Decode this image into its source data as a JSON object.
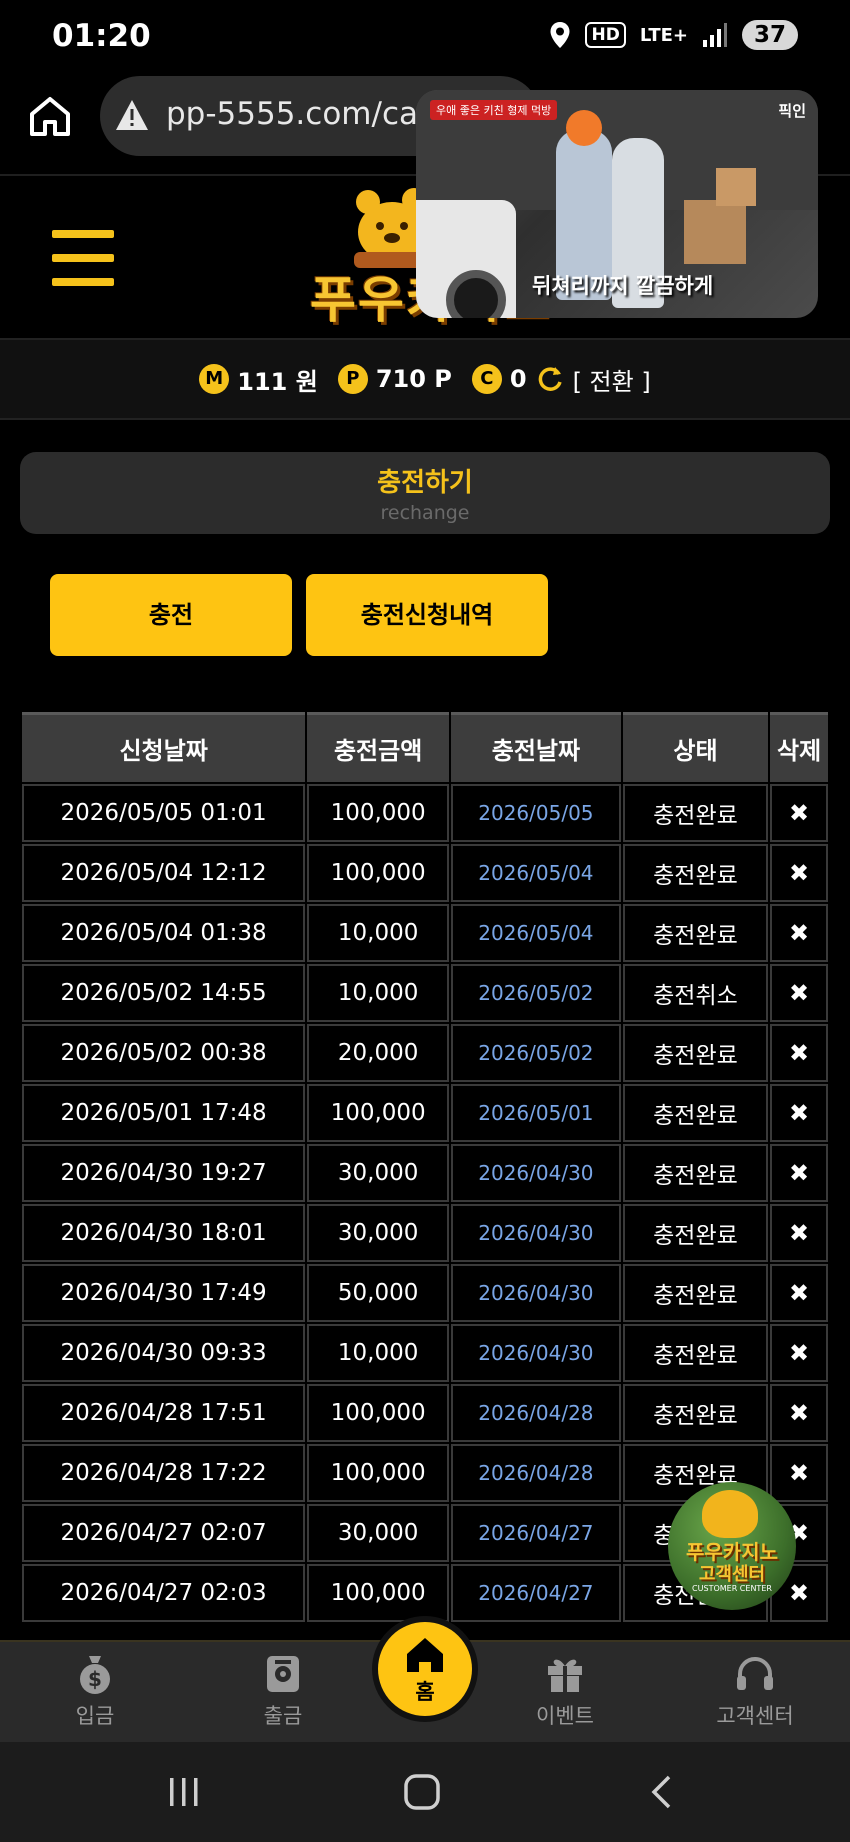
{
  "status_bar": {
    "time": "01:20",
    "hd": "HD",
    "network": "LTE+",
    "battery": "37"
  },
  "browser": {
    "url": "pp-5555.com/cas"
  },
  "pip_video": {
    "channel_tag": "우애 좋은 키친 형제 먹방",
    "corner_label": "픽인",
    "subtitle": "뒤쳐리까지 깔끔하게"
  },
  "header": {
    "logo_text": "푸우카지노"
  },
  "balance": {
    "money_icon": "M",
    "money": "111 원",
    "point_icon": "P",
    "points": "710 P",
    "casino_icon": "C",
    "casino": "0",
    "switch_label": "[ 전환 ]"
  },
  "page_title": {
    "title": "충전하기",
    "subtitle": "rechange"
  },
  "buttons": {
    "charge": "충전",
    "history": "충전신청내역"
  },
  "table": {
    "headers": [
      "신청날짜",
      "충전금액",
      "충전날짜",
      "상태",
      "삭제"
    ],
    "delete_symbol": "✖",
    "rows": [
      {
        "request_date": "2026/05/05 01:01",
        "amount": "100,000",
        "charge_date": "2026/05/05",
        "status": "충전완료"
      },
      {
        "request_date": "2026/05/04 12:12",
        "amount": "100,000",
        "charge_date": "2026/05/04",
        "status": "충전완료"
      },
      {
        "request_date": "2026/05/04 01:38",
        "amount": "10,000",
        "charge_date": "2026/05/04",
        "status": "충전완료"
      },
      {
        "request_date": "2026/05/02 14:55",
        "amount": "10,000",
        "charge_date": "2026/05/02",
        "status": "충전취소"
      },
      {
        "request_date": "2026/05/02 00:38",
        "amount": "20,000",
        "charge_date": "2026/05/02",
        "status": "충전완료"
      },
      {
        "request_date": "2026/05/01 17:48",
        "amount": "100,000",
        "charge_date": "2026/05/01",
        "status": "충전완료"
      },
      {
        "request_date": "2026/04/30 19:27",
        "amount": "30,000",
        "charge_date": "2026/04/30",
        "status": "충전완료"
      },
      {
        "request_date": "2026/04/30 18:01",
        "amount": "30,000",
        "charge_date": "2026/04/30",
        "status": "충전완료"
      },
      {
        "request_date": "2026/04/30 17:49",
        "amount": "50,000",
        "charge_date": "2026/04/30",
        "status": "충전완료"
      },
      {
        "request_date": "2026/04/30 09:33",
        "amount": "10,000",
        "charge_date": "2026/04/30",
        "status": "충전완료"
      },
      {
        "request_date": "2026/04/28 17:51",
        "amount": "100,000",
        "charge_date": "2026/04/28",
        "status": "충전완료"
      },
      {
        "request_date": "2026/04/28 17:22",
        "amount": "100,000",
        "charge_date": "2026/04/28",
        "status": "충전완료"
      },
      {
        "request_date": "2026/04/27 02:07",
        "amount": "30,000",
        "charge_date": "2026/04/27",
        "status": "충전완료"
      },
      {
        "request_date": "2026/04/27 02:03",
        "amount": "100,000",
        "charge_date": "2026/04/27",
        "status": "충전완료"
      }
    ]
  },
  "cs_float": {
    "line1": "푸우카지노",
    "line2": "고객센터",
    "line3": "CUSTOMER CENTER"
  },
  "bottom_nav": {
    "deposit": "입금",
    "withdraw": "출금",
    "home": "홈",
    "event": "이벤트",
    "support": "고객센터"
  },
  "colors": {
    "accent": "#fec412",
    "charge_date_text": "#7aa6e6",
    "background": "#000000"
  }
}
